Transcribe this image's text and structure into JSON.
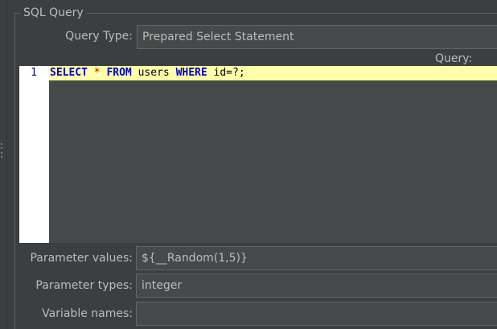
{
  "panel": {
    "legend": "SQL Query"
  },
  "query_type": {
    "label": "Query Type:",
    "value": "Prepared Select Statement"
  },
  "query": {
    "label": "Query:",
    "line_number": "1",
    "tokens": {
      "select": "SELECT",
      "star": "*",
      "from": "FROM",
      "table": "users",
      "where": "WHERE",
      "condition": "id=?;"
    }
  },
  "parameter_values": {
    "label": "Parameter values:",
    "value": "${__Random(1,5)}"
  },
  "parameter_types": {
    "label": "Parameter types:",
    "value": "integer"
  },
  "variable_names": {
    "label": "Variable names:",
    "value": ""
  },
  "colors": {
    "background": "#3c3f41",
    "field_background": "#45494a",
    "current_line_highlight": "#ffffaa",
    "keyword": "#0000c8",
    "operator": "#c80000"
  }
}
